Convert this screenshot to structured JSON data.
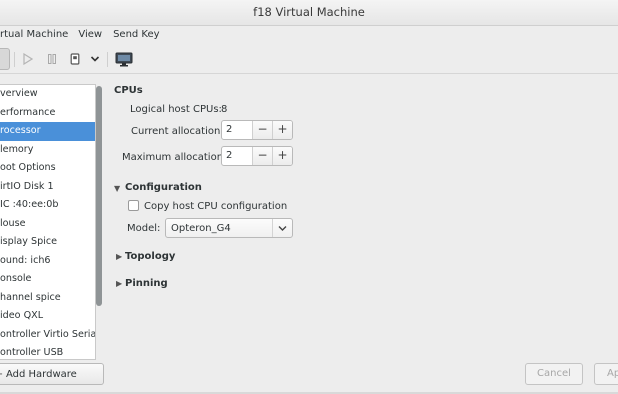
{
  "window": {
    "title": "f18 Virtual Machine"
  },
  "menubar": {
    "items": [
      "rtual Machine",
      "View",
      "Send Key"
    ]
  },
  "toolbar": {
    "icons": [
      "console-view-icon",
      "run-icon",
      "pause-icon",
      "shutdown-icon",
      "dropdown-arrow-icon",
      "screenshot-icon"
    ]
  },
  "sidebar": {
    "items": [
      {
        "label": "verview"
      },
      {
        "label": "erformance"
      },
      {
        "label": "rocessor"
      },
      {
        "label": "lemory"
      },
      {
        "label": "oot Options"
      },
      {
        "label": "irtIO Disk 1"
      },
      {
        "label": "IC :40:ee:0b"
      },
      {
        "label": "louse"
      },
      {
        "label": "isplay Spice"
      },
      {
        "label": "ound: ich6"
      },
      {
        "label": "onsole"
      },
      {
        "label": "hannel spice"
      },
      {
        "label": "ideo QXL"
      },
      {
        "label": "ontroller Virtio Serial"
      },
      {
        "label": "ontroller USB"
      }
    ],
    "selected_index": 2,
    "add_hardware_label": "Add Hardware"
  },
  "cpus": {
    "title": "CPUs",
    "logical_label": "Logical host CPUs:",
    "logical_value": "8",
    "current_label": "Current allocation:",
    "current_value": "2",
    "maximum_label": "Maximum allocation:",
    "maximum_value": "2",
    "minus": "−",
    "plus": "+"
  },
  "configuration": {
    "title": "Configuration",
    "copy_label": "Copy host CPU configuration",
    "copy_checked": false,
    "model_label": "Model:",
    "model_value": "Opteron_G4"
  },
  "topology": {
    "title": "Topology"
  },
  "pinning": {
    "title": "Pinning"
  },
  "footer": {
    "cancel_label": "Cancel",
    "apply_label": "Ap"
  },
  "colors": {
    "selection": "#4a90d9",
    "background": "#ededed"
  }
}
